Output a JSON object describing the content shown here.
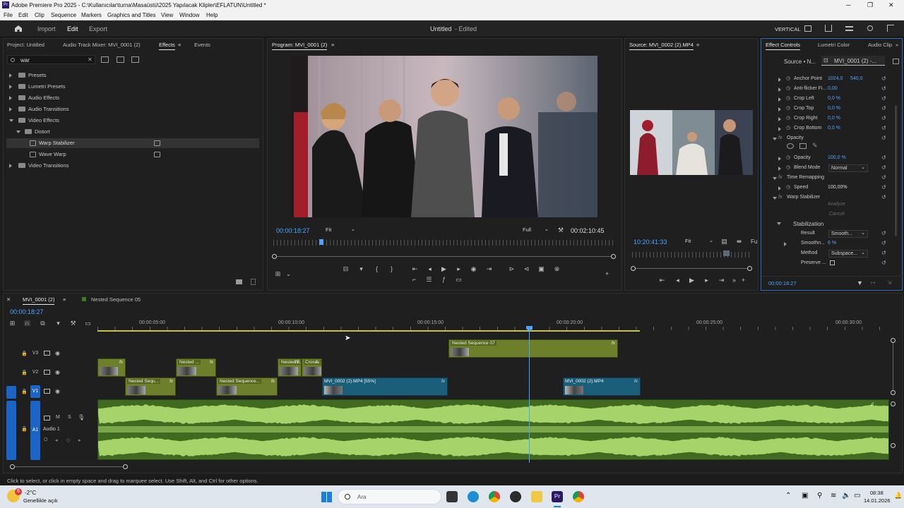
{
  "window": {
    "title": "Adobe Premiere Pro 2025 - C:\\Kullanıcılar\\turna\\Masaüstü\\2025 Yapılacak Klipler\\EFLATUN\\Untitled *",
    "controls": [
      "─",
      "❐",
      "✕"
    ]
  },
  "menu": [
    "File",
    "Edit",
    "Clip",
    "Sequence",
    "Markers",
    "Graphics and Titles",
    "View",
    "Window",
    "Help"
  ],
  "appbar": {
    "tabs": [
      "Import",
      "Edit",
      "Export"
    ],
    "active": "Edit",
    "doc_title": "Untitled",
    "doc_status": "- Edited",
    "workspace": "VERTICAL"
  },
  "project_panel": {
    "tabs": [
      "Project: Untitled",
      "Audio Track Mixer: MVI_0001 (2)",
      "Effects",
      "Events"
    ],
    "active_tab": "Effects",
    "search_value": "war",
    "tree": [
      {
        "label": "Presets",
        "level": 0,
        "expanded": false,
        "type": "folder"
      },
      {
        "label": "Lumetri Presets",
        "level": 0,
        "expanded": false,
        "type": "folder"
      },
      {
        "label": "Audio Effects",
        "level": 0,
        "expanded": false,
        "type": "folder"
      },
      {
        "label": "Audio Transitions",
        "level": 0,
        "expanded": false,
        "type": "folder"
      },
      {
        "label": "Video Effects",
        "level": 0,
        "expanded": true,
        "type": "folder"
      },
      {
        "label": "Distort",
        "level": 1,
        "expanded": true,
        "type": "folder"
      },
      {
        "label": "Warp Stabilizer",
        "level": 2,
        "type": "effect",
        "selected": true
      },
      {
        "label": "Wave Warp",
        "level": 2,
        "type": "effect"
      },
      {
        "label": "Video Transitions",
        "level": 0,
        "expanded": false,
        "type": "folder"
      }
    ]
  },
  "program_monitor": {
    "title": "Program: MVI_0001 (2)",
    "timecode": "00:00:18:27",
    "fit": "Fit",
    "quality": "Full",
    "duration": "00:02:10:45",
    "playhead_fraction": 0.14
  },
  "source_monitor": {
    "title": "Source: MVI_0002 (2).MP4",
    "timecode": "10:20:41:33",
    "fit": "Fit",
    "extra": "Fu",
    "playhead_fraction": 0.78
  },
  "effect_controls": {
    "tabs": [
      "Effect Controls",
      "Lumetri Color",
      "Audio Clip"
    ],
    "source_label": "Source • N...",
    "clip_label": "MVI_0001 (2) -...",
    "rows": [
      {
        "label": "Anchor Point",
        "value": "1024,0",
        "value2": "540,0",
        "indent": 2
      },
      {
        "label": "Anti-flicker Fi...",
        "value": "0,00",
        "indent": 2
      },
      {
        "label": "Crop Left",
        "value": "0,0 %",
        "indent": 2
      },
      {
        "label": "Crop Top",
        "value": "0,0 %",
        "indent": 2
      },
      {
        "label": "Crop Right",
        "value": "0,0 %",
        "indent": 2
      },
      {
        "label": "Crop Bottom",
        "value": "0,0 %",
        "indent": 2
      },
      {
        "label": "Opacity",
        "value": "",
        "indent": 1,
        "section": true
      },
      {
        "label": "Opacity",
        "value": "100,0 %",
        "indent": 2
      },
      {
        "label": "Blend Mode",
        "value": "Normal",
        "indent": 2,
        "dropdown": true
      },
      {
        "label": "Time Remapping",
        "value": "",
        "indent": 1,
        "section": true
      },
      {
        "label": "Speed",
        "value": "100,00%",
        "indent": 2
      },
      {
        "label": "Warp Stabilizer",
        "value": "",
        "indent": 1,
        "section": true
      }
    ],
    "analyze": "Analyze",
    "cancel": "Cancel",
    "stabilization": "Stabilization",
    "stab_rows": [
      {
        "label": "Result",
        "value": "Smooth...",
        "dropdown": true
      },
      {
        "label": "Smoothn...",
        "value": "6 %"
      },
      {
        "label": "Method",
        "value": "Subspace...",
        "dropdown": true
      },
      {
        "label": "Preserve ...",
        "value": ""
      }
    ],
    "timecode": "00:00:18:27"
  },
  "timeline": {
    "tabs": [
      "MVI_0001 (2)",
      "Nested Sequence 05"
    ],
    "timecode": "00:00:18:27",
    "ruler": [
      "00:00:05:00",
      "00:00:10:00",
      "00:00:15:00",
      "00:00:20:00",
      "00:00:25:00",
      "00:00:30:00"
    ],
    "tracks": [
      "V3",
      "V2",
      "V1",
      "A1"
    ],
    "audio_track_name": "Audio 1",
    "clips": [
      {
        "track": "V3",
        "label": "Nested Sequence 07",
        "color": "green"
      },
      {
        "track": "V2",
        "label": "",
        "color": "green"
      },
      {
        "track": "V2",
        "label": "Nested ...",
        "color": "green"
      },
      {
        "track": "V2",
        "label": "Nested S...",
        "color": "green"
      },
      {
        "track": "V2",
        "label": "Cross...",
        "color": "green"
      },
      {
        "track": "V1",
        "label": "Nested Sequ...",
        "color": "green"
      },
      {
        "track": "V1",
        "label": "Nested Sequence...",
        "color": "green"
      },
      {
        "track": "V1",
        "label": "MVI_0002 (2).MP4 [55%]",
        "color": "blue"
      },
      {
        "track": "V1",
        "label": "MVI_0002 (2).MP4",
        "color": "blue"
      }
    ]
  },
  "status": "Click to select, or click in empty space and drag to marquee select. Use Shift, Alt, and Ctrl for other options.",
  "taskbar": {
    "weather_temp": "-2°C",
    "weather_desc": "Genellikle açık",
    "search": "Ara",
    "time": "08:38",
    "date": "14.01.2026",
    "notif_count": "6"
  }
}
